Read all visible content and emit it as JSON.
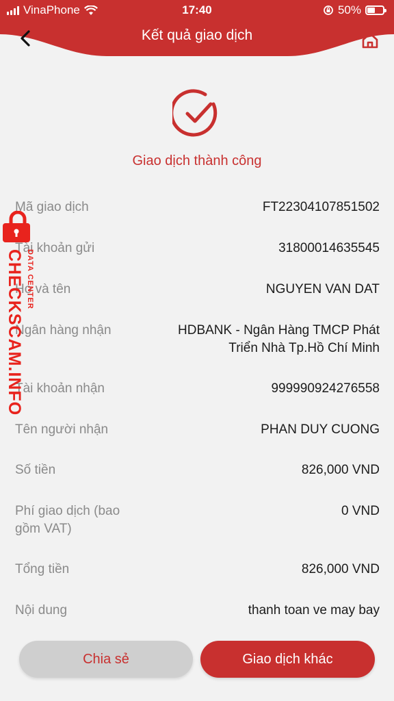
{
  "status_bar": {
    "carrier": "VinaPhone",
    "time": "17:40",
    "battery_percent": "50%",
    "battery_level": 0.5
  },
  "header": {
    "title": "Kết quả giao dịch",
    "back_icon": "chevron-left-icon",
    "home_icon": "home-icon"
  },
  "result": {
    "icon": "check-circle-icon",
    "message": "Giao dịch thành công"
  },
  "details": [
    {
      "label": "Mã giao dịch",
      "value": "FT22304107851502"
    },
    {
      "label": "Tài khoản gửi",
      "value": "31800014635545"
    },
    {
      "label": "Họ và tên",
      "value": "NGUYEN VAN DAT"
    },
    {
      "label": "Ngân hàng nhận",
      "value": "HDBANK - Ngân Hàng TMCP Phát Triển Nhà Tp.Hồ Chí Minh"
    },
    {
      "label": "Tài khoản nhận",
      "value": "999990924276558"
    },
    {
      "label": "Tên người nhận",
      "value": "PHAN DUY CUONG"
    },
    {
      "label": "Số tiền",
      "value": "826,000 VND"
    },
    {
      "label": "Phí giao dịch (bao gồm VAT)",
      "value": "0 VND"
    },
    {
      "label": "Tổng tiền",
      "value": "826,000 VND"
    },
    {
      "label": "Nội dung",
      "value": "thanh toan ve may bay"
    }
  ],
  "watermark": {
    "main": "CHECKSCAM.INFO",
    "sub": "DATA CENTER"
  },
  "buttons": {
    "share": "Chia sẻ",
    "other": "Giao dịch khác"
  },
  "colors": {
    "brand_red": "#c8302f",
    "background": "#f2f2f2",
    "label_gray": "#8a8a8a",
    "share_button_bg": "#cfcfcf"
  }
}
